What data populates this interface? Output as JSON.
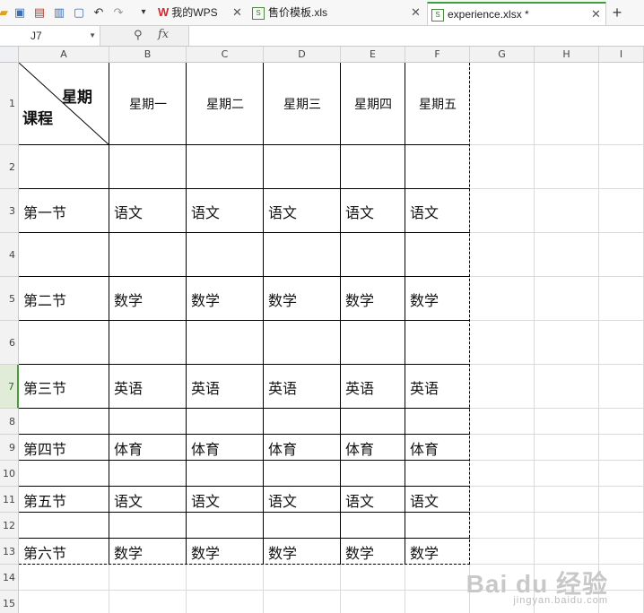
{
  "tabs": [
    {
      "label": "我的WPS",
      "active": false
    },
    {
      "label": "售价模板.xls",
      "active": false
    },
    {
      "label": "experience.xlsx *",
      "active": true
    }
  ],
  "formula_bar": {
    "cell_ref": "J7",
    "fx": "fx",
    "value": ""
  },
  "columns": [
    "A",
    "B",
    "C",
    "D",
    "E",
    "F",
    "G",
    "H",
    "I"
  ],
  "rows": [
    "1",
    "2",
    "3",
    "4",
    "5",
    "6",
    "7",
    "8",
    "9",
    "10",
    "11",
    "12",
    "13",
    "14",
    "15"
  ],
  "selected_row": "7",
  "header_cell": {
    "top_right": "星期",
    "bottom_left": "课程"
  },
  "weekdays": [
    "星期一",
    "星期二",
    "星期三",
    "星期四",
    "星期五"
  ],
  "schedule": [
    {
      "row": "3",
      "period": "第一节",
      "subjects": [
        "语文",
        "语文",
        "语文",
        "语文",
        "语文"
      ]
    },
    {
      "row": "5",
      "period": "第二节",
      "subjects": [
        "数学",
        "数学",
        "数学",
        "数学",
        "数学"
      ]
    },
    {
      "row": "7",
      "period": "第三节",
      "subjects": [
        "英语",
        "英语",
        "英语",
        "英语",
        "英语"
      ]
    },
    {
      "row": "9",
      "period": "第四节",
      "subjects": [
        "体育",
        "体育",
        "体育",
        "体育",
        "体育"
      ]
    },
    {
      "row": "11",
      "period": "第五节",
      "subjects": [
        "语文",
        "语文",
        "语文",
        "语文",
        "语文"
      ]
    },
    {
      "row": "13",
      "period": "第六节",
      "subjects": [
        "数学",
        "数学",
        "数学",
        "数学",
        "数学"
      ]
    }
  ],
  "watermark": {
    "brand": "Bai du 经验",
    "url": "jingyan.baidu.com"
  },
  "colors": {
    "active_tab_accent": "#3ba13b",
    "wps_red": "#d9262c",
    "selected_row_header": "#e0ecd8"
  }
}
